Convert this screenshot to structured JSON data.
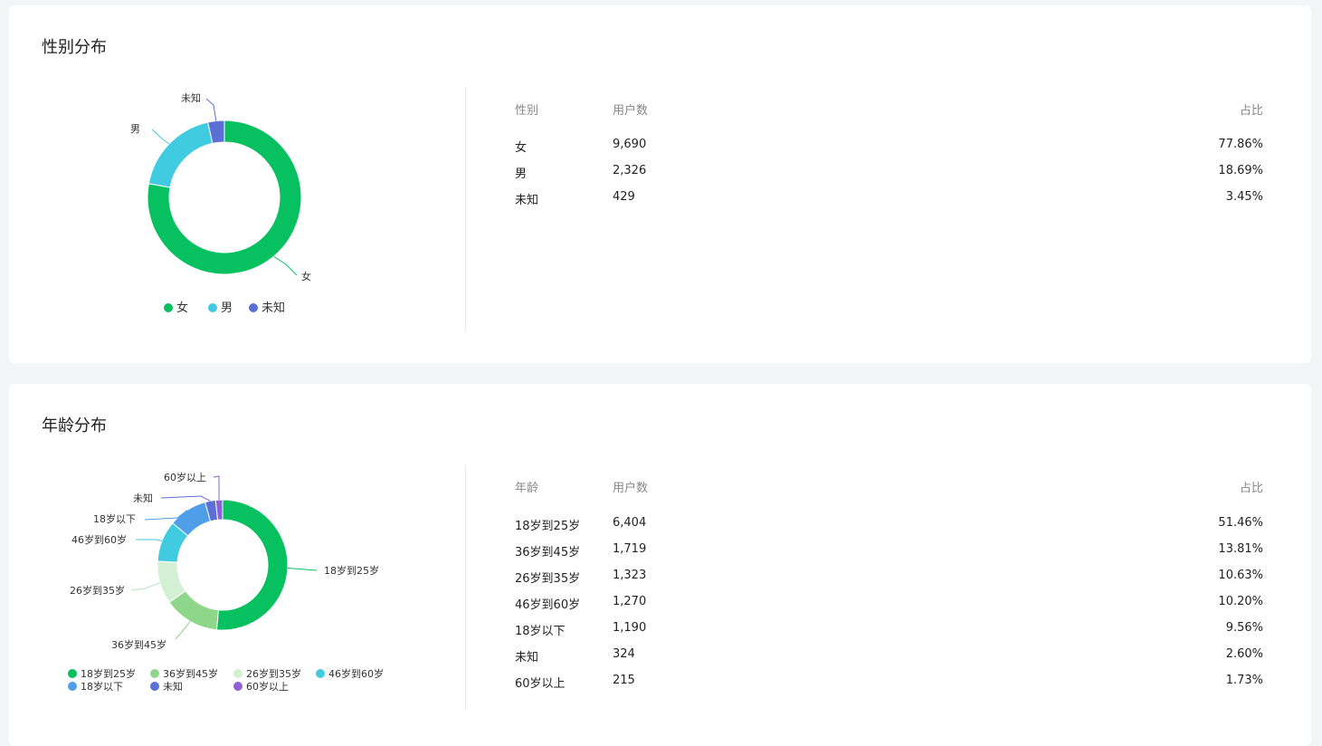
{
  "gender": {
    "title": "性别分布",
    "table_headers": {
      "col1": "性别",
      "col2": "用户数",
      "col3": "占比"
    },
    "rows": [
      {
        "name": "女",
        "users": "9,690",
        "share": "77.86%"
      },
      {
        "name": "男",
        "users": "2,326",
        "share": "18.69%"
      },
      {
        "name": "未知",
        "users": "429",
        "share": "3.45%"
      }
    ]
  },
  "age": {
    "title": "年龄分布",
    "table_headers": {
      "col1": "年龄",
      "col2": "用户数",
      "col3": "占比"
    },
    "rows": [
      {
        "name": "18岁到25岁",
        "users": "6,404",
        "share": "51.46%"
      },
      {
        "name": "36岁到45岁",
        "users": "1,719",
        "share": "13.81%"
      },
      {
        "name": "26岁到35岁",
        "users": "1,323",
        "share": "10.63%"
      },
      {
        "name": "46岁到60岁",
        "users": "1,270",
        "share": "10.20%"
      },
      {
        "name": "18岁以下",
        "users": "1,190",
        "share": "9.56%"
      },
      {
        "name": "未知",
        "users": "324",
        "share": "2.60%"
      },
      {
        "name": "60岁以上",
        "users": "215",
        "share": "1.73%"
      }
    ]
  },
  "chart_data": [
    {
      "type": "pie",
      "variant": "donut",
      "categories": [
        "女",
        "男",
        "未知"
      ],
      "values": [
        9690,
        2326,
        429
      ],
      "colors": [
        "#07c160",
        "#40cbe0",
        "#5b6fd4"
      ],
      "legend": "bottom"
    },
    {
      "type": "pie",
      "variant": "donut",
      "categories": [
        "18岁到25岁",
        "36岁到45岁",
        "26岁到35岁",
        "46岁到60岁",
        "18岁以下",
        "未知",
        "60岁以上"
      ],
      "values": [
        6404,
        1719,
        1323,
        1270,
        1190,
        324,
        215
      ],
      "colors": [
        "#07c160",
        "#8ed68a",
        "#d3f0d4",
        "#40cbe0",
        "#4f9ee8",
        "#5b6fd4",
        "#8e62d6"
      ],
      "legend": "bottom"
    }
  ]
}
